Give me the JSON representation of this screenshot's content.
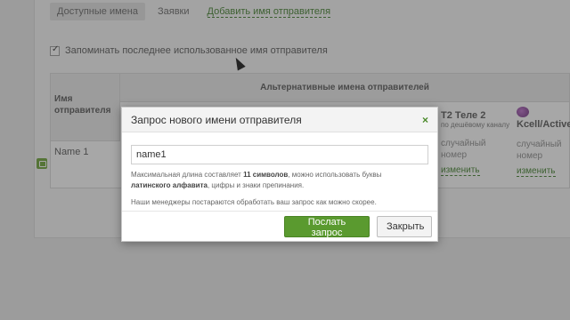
{
  "tabs": {
    "available": "Доступные имена",
    "requests": "Заявки",
    "add_sender": "Добавить имя отправителя"
  },
  "remember_label": "Запоминать последнее использованное имя отправителя",
  "table": {
    "col_name": "Имя отправителя",
    "col_alt": "Альтернативные имена отправителей",
    "row_name": "Name 1",
    "operators": [
      {
        "title": "Т2 Теле 2",
        "subtitle": "по дешёвому каналу",
        "value": "случайный номер",
        "link": "изменить"
      },
      {
        "title": "Kcell/Active",
        "subtitle": "",
        "value": "случайный номер",
        "link": "изменить"
      }
    ]
  },
  "modal": {
    "title": "Запрос нового имени отправителя",
    "input_value": "name1",
    "hint_part1": "Максимальная длина составляет ",
    "hint_bold1": "11 символов",
    "hint_part2": ", можно использовать буквы ",
    "hint_bold2": "латинского алфавита",
    "hint_part3": ", цифры и знаки препинания.",
    "hint_managers": "Наши менеджеры постараются обработать ваш запрос как можно скорее.",
    "submit_label": "Послать запрос",
    "close_label": "Закрыть",
    "close_icon": "×"
  },
  "colors": {
    "accent_green": "#5a9a2f",
    "link_green": "#3f7f2a"
  }
}
